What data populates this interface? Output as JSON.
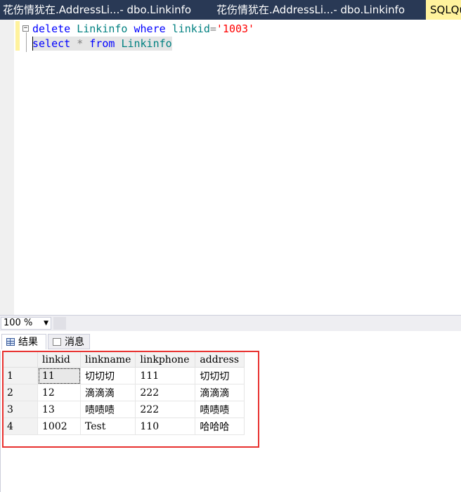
{
  "tabs": [
    {
      "label": "花伤情犹在.AddressLi...- dbo.Linkinfo"
    },
    {
      "label": "花伤情犹在.AddressLi...- dbo.Linkinfo"
    },
    {
      "label": "SQLQu"
    }
  ],
  "editor": {
    "line1": {
      "kw1": "delete",
      "ident1": "Linkinfo",
      "kw2": "where",
      "ident2": "linkid",
      "op": "=",
      "str": "'1003'"
    },
    "line2": {
      "kw1": "select",
      "op": "*",
      "kw2": "from",
      "ident": "Linkinfo"
    }
  },
  "zoom": {
    "value": "100 %",
    "arrow": "▼"
  },
  "result_tabs": {
    "results": "结果",
    "messages": "消息"
  },
  "grid": {
    "columns": [
      "linkid",
      "linkname",
      "linkphone",
      "address"
    ],
    "rows": [
      {
        "rownum": "1",
        "cells": [
          "11",
          "切切切",
          "111",
          "切切切"
        ]
      },
      {
        "rownum": "2",
        "cells": [
          "12",
          "滴滴滴",
          "222",
          "滴滴滴"
        ]
      },
      {
        "rownum": "3",
        "cells": [
          "13",
          "啧啧啧",
          "222",
          "啧啧啧"
        ]
      },
      {
        "rownum": "4",
        "cells": [
          "1002",
          "Test",
          "110",
          "哈哈哈"
        ]
      }
    ]
  },
  "colors": {
    "tabbar": "#293955",
    "active_tab": "#fff29d",
    "highlight_box": "#e8312f",
    "keyword": "#0000ff",
    "string": "#ff0000",
    "identifier": "#008080"
  }
}
